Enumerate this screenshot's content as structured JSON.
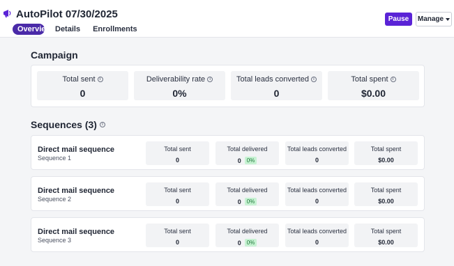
{
  "header": {
    "title": "AutoPilot 07/30/2025",
    "tabs": [
      {
        "label": "Overview"
      },
      {
        "label": "Details"
      },
      {
        "label": "Enrollments"
      }
    ],
    "pause_label": "Pause",
    "manage_label": "Manage"
  },
  "campaign": {
    "title": "Campaign",
    "stats": [
      {
        "label": "Total sent",
        "value": "0"
      },
      {
        "label": "Deliverability rate",
        "value": "0%"
      },
      {
        "label": "Total leads converted",
        "value": "0"
      },
      {
        "label": "Total spent",
        "value": "$0.00"
      }
    ]
  },
  "sequences": {
    "title": "Sequences (3)",
    "items": [
      {
        "name": "Direct mail sequence",
        "sub": "Sequence 1",
        "sent_label": "Total sent",
        "sent": "0",
        "delivered_label": "Total delivered",
        "delivered": "0",
        "delivered_pct": "0%",
        "converted_label": "Total leads converted",
        "converted": "0",
        "spent_label": "Total spent",
        "spent": "$0.00"
      },
      {
        "name": "Direct mail sequence",
        "sub": "Sequence 2",
        "sent_label": "Total sent",
        "sent": "0",
        "delivered_label": "Total delivered",
        "delivered": "0",
        "delivered_pct": "0%",
        "converted_label": "Total leads converted",
        "converted": "0",
        "spent_label": "Total spent",
        "spent": "$0.00"
      },
      {
        "name": "Direct mail sequence",
        "sub": "Sequence 3",
        "sent_label": "Total sent",
        "sent": "0",
        "delivered_label": "Total delivered",
        "delivered": "0",
        "delivered_pct": "0%",
        "converted_label": "Total leads converted",
        "converted": "0",
        "spent_label": "Total spent",
        "spent": "$0.00"
      }
    ]
  },
  "icons": {
    "app": "megaphone-icon",
    "info": "info-icon",
    "caret": "chevron-down-icon"
  },
  "colors": {
    "accent": "#5a23d6",
    "tab_active": "#4a2aa8",
    "badge_bg": "#c7f2d3",
    "badge_text": "#1f7a3a"
  }
}
